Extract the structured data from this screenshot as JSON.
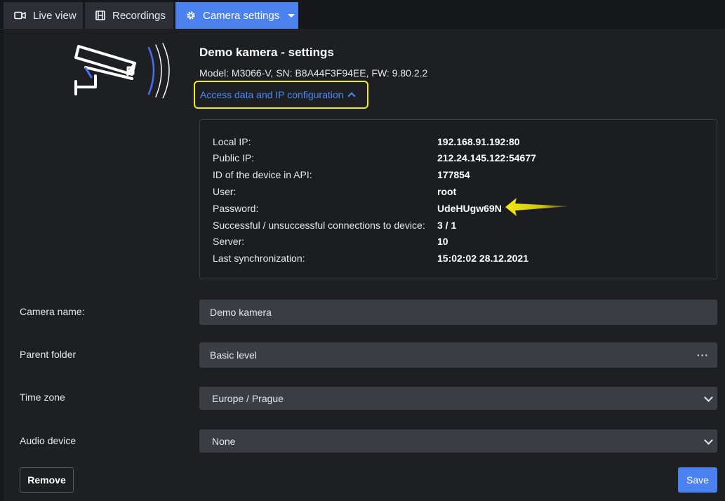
{
  "tabs": [
    {
      "label": "Live view",
      "icon": "video-camera-icon"
    },
    {
      "label": "Recordings",
      "icon": "film-icon"
    },
    {
      "label": "Camera settings",
      "icon": "gear-icon",
      "active": true
    }
  ],
  "colors": {
    "accent": "#4b82f0",
    "highlight": "#f2ea1b",
    "link": "#4b8bf5"
  },
  "header": {
    "title": "Demo kamera - settings",
    "model_line": "Model: M3066-V, SN: B8A44F3F94EE, FW: 9.80.2.2",
    "access_toggle": "Access data and IP configuration"
  },
  "info": [
    {
      "label": "Local IP:",
      "value": "192.168.91.192:80"
    },
    {
      "label": "Public IP:",
      "value": "212.24.145.122:54677"
    },
    {
      "label": "ID of the device in API:",
      "value": "177854"
    },
    {
      "label": "User:",
      "value": "root"
    },
    {
      "label": "Password:",
      "value": "UdeHUgw69N"
    },
    {
      "label": "Successful / unsuccessful connections to device:",
      "value": "3 / 1"
    },
    {
      "label": "Server:",
      "value": "10"
    },
    {
      "label": "Last synchronization:",
      "value": "15:02:02 28.12.2021"
    }
  ],
  "form": {
    "camera_name": {
      "label": "Camera name:",
      "value": "Demo kamera"
    },
    "parent_folder": {
      "label": "Parent folder",
      "value": "Basic level",
      "more": "···"
    },
    "time_zone": {
      "label": "Time zone",
      "value": "Europe / Prague"
    },
    "audio_device": {
      "label": "Audio device",
      "value": "None"
    }
  },
  "buttons": {
    "remove": "Remove",
    "save": "Save"
  }
}
